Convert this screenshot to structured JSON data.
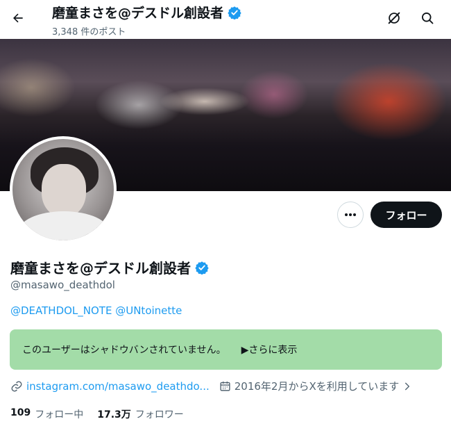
{
  "topbar": {
    "title": "磨童まさを@デスドル創設者",
    "post_count": "3,348 件のポスト"
  },
  "profile": {
    "name": "磨童まさを@デスドル創設者",
    "handle": "@masawo_deathdol",
    "bio_mention_1": "@DEATHDOL_NOTE",
    "bio_mention_2": "@UNtoinette",
    "follow_label": "フォロー",
    "shadowban_text": "このユーザーはシャドウバンされていません。",
    "show_more_label": "▶さらに表示",
    "website": "instagram.com/masawo_deathdo...",
    "joined": "2016年2月からXを利用しています"
  },
  "stats": {
    "following_count": "109",
    "following_label": "フォロー中",
    "followers_count": "17.3万",
    "followers_label": "フォロワー"
  },
  "colors": {
    "accent": "#1d9bf0",
    "notice_bg": "#a3dca8",
    "text_primary": "#0f1419",
    "text_secondary": "#536471"
  },
  "icons": [
    "back-arrow-icon",
    "verified-badge-icon",
    "grok-icon",
    "search-icon",
    "more-icon",
    "link-icon",
    "calendar-icon",
    "chevron-right-icon"
  ]
}
